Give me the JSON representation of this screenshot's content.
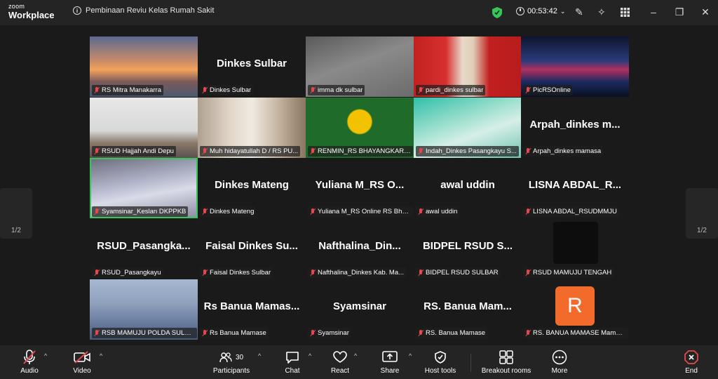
{
  "app": {
    "brand_small": "zoom",
    "brand_main": "Workplace"
  },
  "meeting": {
    "title": "Pembinaan Reviu Kelas Rumah Sakit",
    "timer": "00:53:42"
  },
  "colors": {
    "accent": "#35c759",
    "muted": "#e5484d",
    "avatar": "#f26b2a",
    "nav_arrow": "#1e90ff"
  },
  "pager": {
    "left": "1/2",
    "right": "1/2"
  },
  "tiles": [
    {
      "name": "RS Mitra Manakarra",
      "big": "",
      "img": "bridge"
    },
    {
      "name": "Dinkes Sulbar",
      "big": "Dinkes Sulbar"
    },
    {
      "name": "imma dk sulbar",
      "big": "",
      "img": "dim"
    },
    {
      "name": "pardi_dinkes sulbar",
      "big": "",
      "img": "portrait"
    },
    {
      "name": "PicRSOnline",
      "big": "",
      "img": "server"
    },
    {
      "name": "RSUD Hajjah Andi Depu",
      "big": "",
      "img": "office"
    },
    {
      "name": "Muh hidayatullah D / RS PU...",
      "big": "",
      "img": "logo"
    },
    {
      "name": "RENMIN_RS BHAYANGKARA...",
      "big": "",
      "img": "green"
    },
    {
      "name": "Indah_Dinkes Pasangkayu S...",
      "big": "",
      "img": "slide"
    },
    {
      "name": "Arpah_dinkes mamasa",
      "big": "Arpah_dinkes m..."
    },
    {
      "name": "Syamsinar_Keslan DKPPKB",
      "big": "",
      "img": "face"
    },
    {
      "name": "Dinkes Mateng",
      "big": "Dinkes Mateng"
    },
    {
      "name": "Yuliana M_RS Online RS Bha...",
      "big": "Yuliana M_RS O..."
    },
    {
      "name": "awal uddin",
      "big": "awal uddin"
    },
    {
      "name": "LISNA ABDAL_RSUDMMJU",
      "big": "LISNA ABDAL_R..."
    },
    {
      "name": "RSUD_Pasangkayu",
      "big": "RSUD_Pasangka..."
    },
    {
      "name": "Faisal Dinkes Sulbar",
      "big": "Faisal Dinkes Su..."
    },
    {
      "name": "Nafthalina_Dinkes Kab. Ma...",
      "big": "Nafthalina_Din..."
    },
    {
      "name": "BIDPEL RSUD SULBAR",
      "big": "BIDPEL RSUD S..."
    },
    {
      "name": "RSUD MAMUJU TENGAH",
      "big": "",
      "img": "darkavatar"
    },
    {
      "name": "RSB MAMUJU POLDA SULBAR",
      "big": "",
      "img": "blur"
    },
    {
      "name": "Rs Banua Mamase",
      "big": "Rs Banua Mamas..."
    },
    {
      "name": "Syamsinar",
      "big": "Syamsinar"
    },
    {
      "name": "RS. Banua Mamase",
      "big": "RS. Banua Mam..."
    },
    {
      "name": "RS. BANUA MAMASE Mamasa",
      "big": "",
      "img": "R",
      "avatar_letter": "R"
    }
  ],
  "toolbar": {
    "audio": "Audio",
    "video": "Video",
    "participants": "Participants",
    "participants_count": "30",
    "chat": "Chat",
    "react": "React",
    "share": "Share",
    "host_tools": "Host tools",
    "breakout": "Breakout rooms",
    "more": "More",
    "end": "End"
  }
}
